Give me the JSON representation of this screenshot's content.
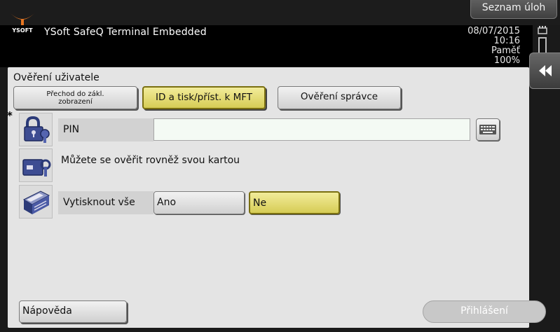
{
  "topbar": {
    "job_list_label": "Seznam úloh"
  },
  "header": {
    "logo_text": "YSOFT",
    "app_title": "YSoft SafeQ Terminal Embedded",
    "date": "08/07/2015",
    "time": "10:16",
    "memory_label": "Paměť",
    "memory_value": "100%"
  },
  "section_title": "Ověření uživatele",
  "tabs": [
    {
      "label": "Přechod do zákl. zobrazení",
      "selected": false
    },
    {
      "label": "ID a tisk/příst. k MFT",
      "selected": true
    },
    {
      "label": "Ověření správce",
      "selected": false
    }
  ],
  "required_mark": "*",
  "pin": {
    "label": "PIN",
    "value": ""
  },
  "card_text": "Můžete se ověřit rovněž svou kartou",
  "print_all": {
    "label": "Vytisknout vše",
    "options": [
      "Ano",
      "Ne"
    ],
    "selected": "Ne"
  },
  "footer": {
    "help_label": "Nápověda",
    "login_label": "Přihlášení"
  },
  "colors": {
    "selected_fill": "#d9cf55",
    "panel_bg": "#e4e4e4",
    "header_bg": "#000000"
  },
  "icons": [
    "lock-key-icon",
    "card-reader-icon",
    "printer-icon",
    "keyboard-icon",
    "double-chevron-left-icon",
    "memory-icon"
  ]
}
